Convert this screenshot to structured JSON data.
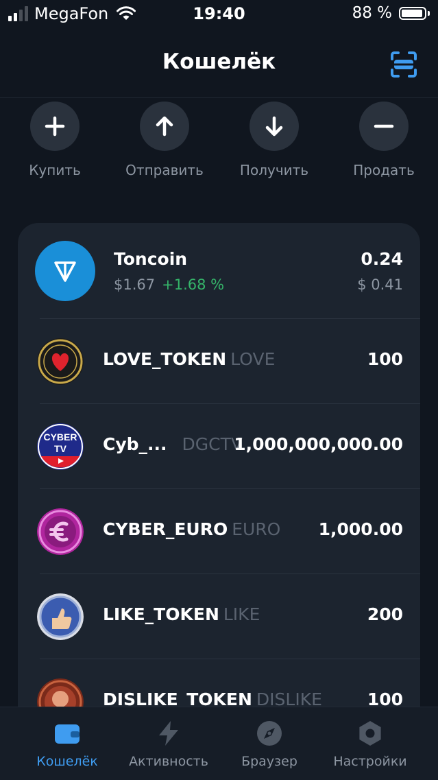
{
  "status": {
    "carrier": "MegaFon",
    "time": "19:40",
    "battery": "88 %"
  },
  "header": {
    "title": "Кошелёк"
  },
  "actions": [
    {
      "label": "Купить",
      "icon": "plus-icon"
    },
    {
      "label": "Отправить",
      "icon": "arrow-up-icon"
    },
    {
      "label": "Получить",
      "icon": "arrow-down-icon"
    },
    {
      "label": "Продать",
      "icon": "minus-icon"
    }
  ],
  "main_coin": {
    "name": "Toncoin",
    "price": "$1.67",
    "change": "+1.68 %",
    "amount": "0.24",
    "usd_value": "$ 0.41"
  },
  "tokens": [
    {
      "name": "LOVE_TOKEN",
      "ticker": "LOVE",
      "amount": "100"
    },
    {
      "name": "Cyb_...",
      "ticker": "DGCTV",
      "amount": "1,000,000,000.00"
    },
    {
      "name": "CYBER_EURO",
      "ticker": "EURO",
      "amount": "1,000.00"
    },
    {
      "name": "LIKE_TOKEN",
      "ticker": "LIKE",
      "amount": "200"
    },
    {
      "name": "DISLIKE_TOKEN",
      "ticker": "DISLIKE",
      "amount": "100"
    }
  ],
  "token_icon_text": {
    "cyber_line1": "CYBER",
    "cyber_line2": "TV"
  },
  "tabs": [
    {
      "label": "Кошелёк",
      "icon": "wallet-icon",
      "active": true
    },
    {
      "label": "Активность",
      "icon": "lightning-icon",
      "active": false
    },
    {
      "label": "Браузер",
      "icon": "compass-icon",
      "active": false
    },
    {
      "label": "Настройки",
      "icon": "settings-icon",
      "active": false
    }
  ],
  "colors": {
    "background": "#10161f",
    "card": "#1c242f",
    "accent": "#3f9cf0",
    "positive": "#35b56a",
    "ton_blue": "#1a8fd8"
  }
}
